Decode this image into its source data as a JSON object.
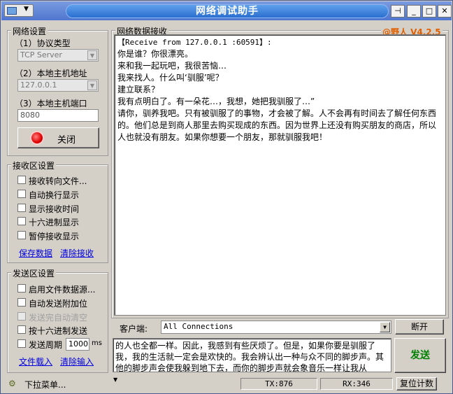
{
  "window": {
    "title": "网络调试助手",
    "version_badge": "@野人 V4.2.5"
  },
  "net_settings": {
    "group_title": "网络设置",
    "protocol_label": "（1）协议类型",
    "protocol_value": "TCP Server",
    "host_label": "（2）本地主机地址",
    "host_value": "127.0.0.1",
    "port_label": "（3）本地主机端口",
    "port_value": "8080",
    "toggle_button": "关闭"
  },
  "receive_settings": {
    "group_title": "接收区设置",
    "options": [
      "接收转向文件...",
      "自动换行显示",
      "显示接收时间",
      "十六进制显示",
      "暂停接收显示"
    ],
    "save_link": "保存数据",
    "clear_link": "清除接收"
  },
  "send_settings": {
    "group_title": "发送区设置",
    "options": [
      "启用文件数据源...",
      "自动发送附加位",
      "发送完自动清空",
      "按十六进制发送"
    ],
    "period_label": "发送周期",
    "period_value": "1000",
    "period_unit": "ms",
    "load_link": "文件载入",
    "clear_link": "清除输入"
  },
  "receive_area": {
    "group_title": "网络数据接收",
    "header_line": "【Receive from 127.0.0.1 :60591】:",
    "lines": [
      "你是谁？你很漂亮。",
      "来和我一起玩吧，我很苦恼…",
      "我来找人。什么叫‘驯服’呢？",
      "建立联系？",
      "我有点明白了。有一朵花…，我想，她把我驯服了…”",
      "请你，驯养我吧。只有被驯服了的事物，才会被了解。人不会再有时间去了解任何东西的。他们总是到商人那里去购买现成的东西。因为世界上还没有购买朋友的商店，所以人也就没有朋友。如果你想要一个朋友，那就驯服我吧！"
    ]
  },
  "client_bar": {
    "label": "客户端:",
    "value": "All Connections",
    "disconnect_button": "断开"
  },
  "send_area": {
    "text": "的人也全都一样。因此，我感到有些厌烦了。但是，如果你要是驯服了我，我的生活就一定会是欢快的。我会辨认出一种与众不同的脚步声。其他的脚步声会使我躲到地下去，而你的脚步声就会象音乐一样让我从",
    "send_button": "发送"
  },
  "statusbar": {
    "menu_label": "下拉菜单...",
    "tx": "TX:876",
    "rx": "RX:346",
    "reset_button": "复位计数"
  },
  "colors": {
    "title_blue": "#2a6fd0",
    "badge_orange": "#e06000",
    "send_green": "#008000",
    "link_blue": "#0000e0"
  }
}
